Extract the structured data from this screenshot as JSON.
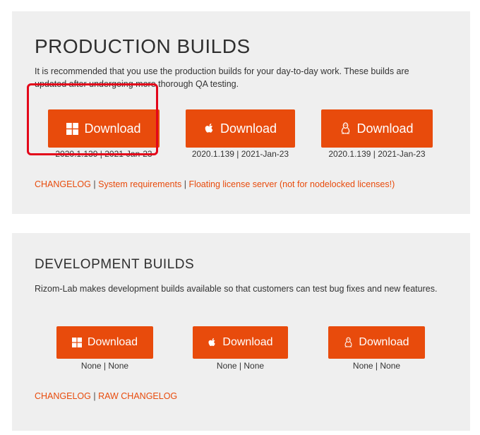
{
  "production": {
    "title": "PRODUCTION BUILDS",
    "description": "It is recommended that you use the production builds for your day-to-day work. These builds are updated after undergoing more thorough QA testing.",
    "downloads": [
      {
        "os": "windows",
        "icon": "windows-icon",
        "label": "Download",
        "version": "2020.1.139 | 2021-Jan-23"
      },
      {
        "os": "mac",
        "icon": "apple-icon",
        "label": "Download",
        "version": "2020.1.139 | 2021-Jan-23"
      },
      {
        "os": "linux",
        "icon": "linux-icon",
        "label": "Download",
        "version": "2020.1.139 | 2021-Jan-23"
      }
    ],
    "links": {
      "changelog": "CHANGELOG",
      "system_requirements": "System requirements",
      "floating_license": "Floating license server (not for nodelocked licenses!)",
      "separator": "|"
    }
  },
  "development": {
    "title": "DEVELOPMENT BUILDS",
    "description": "Rizom-Lab makes development builds available so that customers can test bug fixes and new features.",
    "downloads": [
      {
        "os": "windows",
        "icon": "windows-icon",
        "label": "Download",
        "version": "None | None"
      },
      {
        "os": "mac",
        "icon": "apple-icon",
        "label": "Download",
        "version": "None | None"
      },
      {
        "os": "linux",
        "icon": "linux-icon",
        "label": "Download",
        "version": "None | None"
      }
    ],
    "links": {
      "changelog": "CHANGELOG",
      "raw_changelog": "RAW CHANGELOG",
      "separator": "|"
    }
  },
  "colors": {
    "accent": "#e84b0c",
    "highlight_box": "#e3061a",
    "panel_background": "#efefef"
  }
}
